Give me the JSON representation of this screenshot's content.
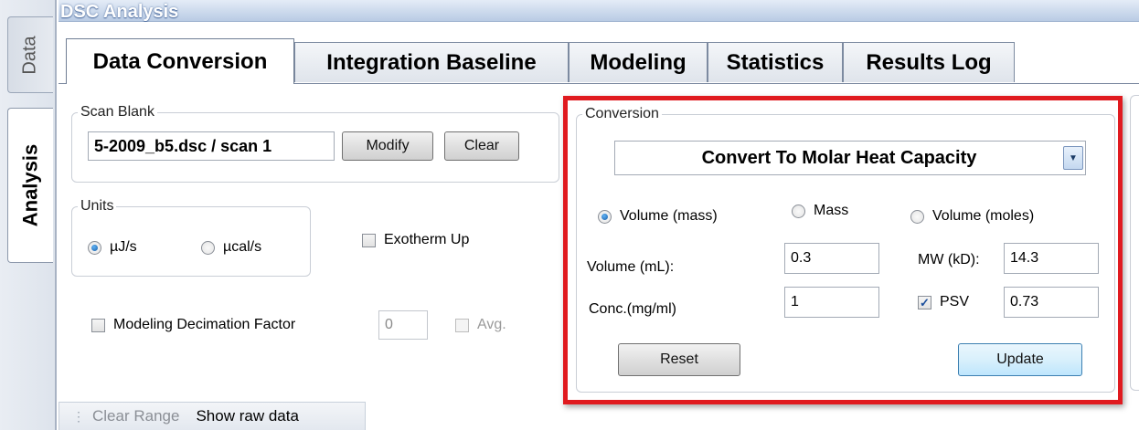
{
  "side_tabs": [
    {
      "label": "Data",
      "active": false
    },
    {
      "label": "Analysis",
      "active": true
    }
  ],
  "app_title": "DSC Analysis",
  "tabs": [
    {
      "label": "Data Conversion",
      "active": true
    },
    {
      "label": "Integration Baseline",
      "active": false
    },
    {
      "label": "Modeling",
      "active": false
    },
    {
      "label": "Statistics",
      "active": false
    },
    {
      "label": "Results Log",
      "active": false
    }
  ],
  "scan_blank": {
    "legend": "Scan Blank",
    "value": "5-2009_b5.dsc / scan 1",
    "modify_label": "Modify",
    "clear_label": "Clear"
  },
  "units": {
    "legend": "Units",
    "options": [
      {
        "label": "µJ/s",
        "selected": true
      },
      {
        "label": "µcal/s",
        "selected": false
      }
    ]
  },
  "exotherm_up": {
    "label": "Exotherm Up",
    "checked": false
  },
  "modeling": {
    "decimation_label": "Modeling Decimation Factor",
    "decimation_checked": false,
    "decimation_value": "0",
    "avg_label": "Avg.",
    "avg_checked": false
  },
  "conversion": {
    "legend": "Conversion",
    "mode": "Convert To Molar Heat Capacity",
    "options": [
      {
        "label": "Volume (mass)",
        "selected": true
      },
      {
        "label": "Mass",
        "selected": false
      },
      {
        "label": "Volume (moles)",
        "selected": false
      }
    ],
    "volume_label": "Volume (mL):",
    "volume_value": "0.3",
    "mw_label": "MW (kD):",
    "mw_value": "14.3",
    "conc_label": "Conc.(mg/ml)",
    "conc_value": "1",
    "psv_label": "PSV",
    "psv_checked": true,
    "psv_value": "0.73",
    "reset_label": "Reset",
    "update_label": "Update",
    "check_glyph": "✓"
  },
  "toolbar": {
    "clear_range_label": "Clear Range",
    "show_raw_label": "Show raw data"
  },
  "colors": {
    "highlight": "#e01a1f",
    "header_gradient_bottom": "#b9cbe4",
    "radio_selected": "#1a5fa8"
  }
}
